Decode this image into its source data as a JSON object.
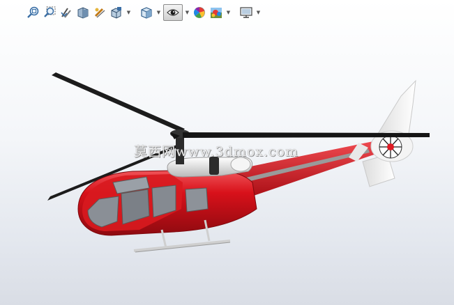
{
  "toolbar": {
    "items": [
      {
        "icon": "zoom-to-fit-icon"
      },
      {
        "icon": "zoom-to-area-icon"
      },
      {
        "icon": "previous-view-icon"
      },
      {
        "icon": "section-view-icon"
      },
      {
        "icon": "dynamic-annotation-views-icon"
      },
      {
        "icon": "view-orientation-icon",
        "dropdown": true
      },
      {
        "icon": "display-style-icon",
        "dropdown": true
      },
      {
        "icon": "hide-show-items-icon",
        "dropdown": true,
        "active": true
      },
      {
        "icon": "edit-appearance-icon"
      },
      {
        "icon": "apply-scene-icon",
        "dropdown": true
      },
      {
        "icon": "view-settings-icon",
        "dropdown": true
      }
    ]
  },
  "viewport": {
    "model": "helicopter",
    "body_color": "#d8111a",
    "background_top": "#ffffff",
    "background_bottom": "#d9dde5"
  },
  "watermark": {
    "text": "莫西网www.3dmox.com"
  }
}
